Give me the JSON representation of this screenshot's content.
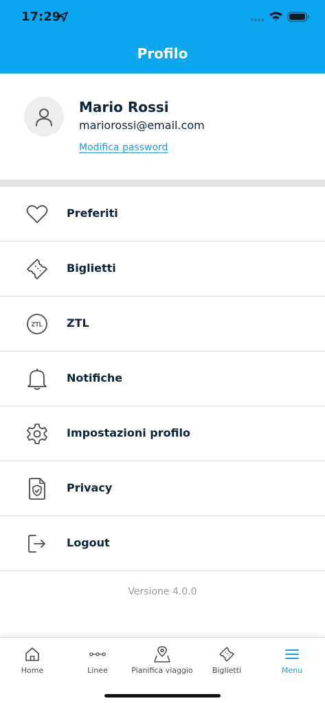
{
  "status_bar": {
    "time": "17:29"
  },
  "header": {
    "title": "Profilo"
  },
  "profile": {
    "name": "Mario Rossi",
    "email": "mariorossi@email.com",
    "edit_password_label": "Modifica password"
  },
  "menu": {
    "items": [
      {
        "label": "Preferiti",
        "icon": "heart-icon"
      },
      {
        "label": "Biglietti",
        "icon": "ticket-icon"
      },
      {
        "label": "ZTL",
        "icon": "ztl-icon",
        "icon_text": "ZTL"
      },
      {
        "label": "Notifiche",
        "icon": "bell-icon"
      },
      {
        "label": "Impostazioni profilo",
        "icon": "gear-icon"
      },
      {
        "label": "Privacy",
        "icon": "shield-document-icon"
      },
      {
        "label": "Logout",
        "icon": "logout-icon"
      }
    ]
  },
  "version": "Versione 4.0.0",
  "tabbar": {
    "tabs": [
      {
        "label": "Home",
        "icon": "home-icon"
      },
      {
        "label": "Linee",
        "icon": "route-line-icon"
      },
      {
        "label": "Pianifica viaggio",
        "icon": "map-pin-icon"
      },
      {
        "label": "Biglietti",
        "icon": "ticket-icon"
      },
      {
        "label": "Menu",
        "icon": "menu-icon",
        "active": true
      }
    ]
  },
  "colors": {
    "header": "#0aa6ee",
    "accent": "#1b9fe0",
    "text": "#0f2233",
    "version_text": "#9a9a9a"
  }
}
